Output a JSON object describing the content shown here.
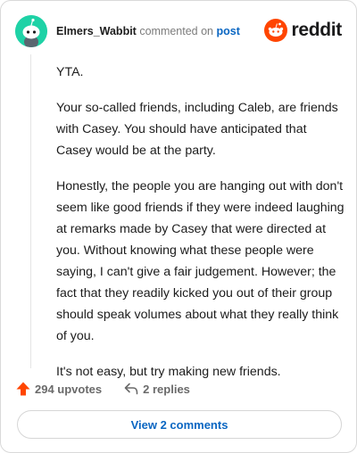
{
  "comment": {
    "username": "Elmers_Wabbit",
    "action_text": "commented on",
    "post_link": "post",
    "paragraphs": [
      "YTA.",
      "Your so-called friends, including Caleb, are friends with Casey. You should have anticipated that Casey would be at the party.",
      "Honestly, the people you are hanging out with don't seem like good friends if they were indeed laughing at remarks made by Casey that were directed at you. Without knowing what these people were saying, I can't give a fair judgement. However; the fact that they readily kicked you out of their group should speak volumes about what they really think of you.",
      "It's not easy, but try making new friends."
    ]
  },
  "brand": {
    "logo_text": "reddit",
    "color": "#ff4500"
  },
  "footer": {
    "upvotes_label": "294 upvotes",
    "replies_label": "2 replies",
    "upvote_color": "#ff4500"
  },
  "view_comments_label": "View 2 comments",
  "icons": {
    "avatar": "snoo-avatar-icon",
    "logo": "reddit-logo-icon",
    "upvote": "upvote-arrow-icon",
    "reply": "reply-arrow-icon"
  }
}
